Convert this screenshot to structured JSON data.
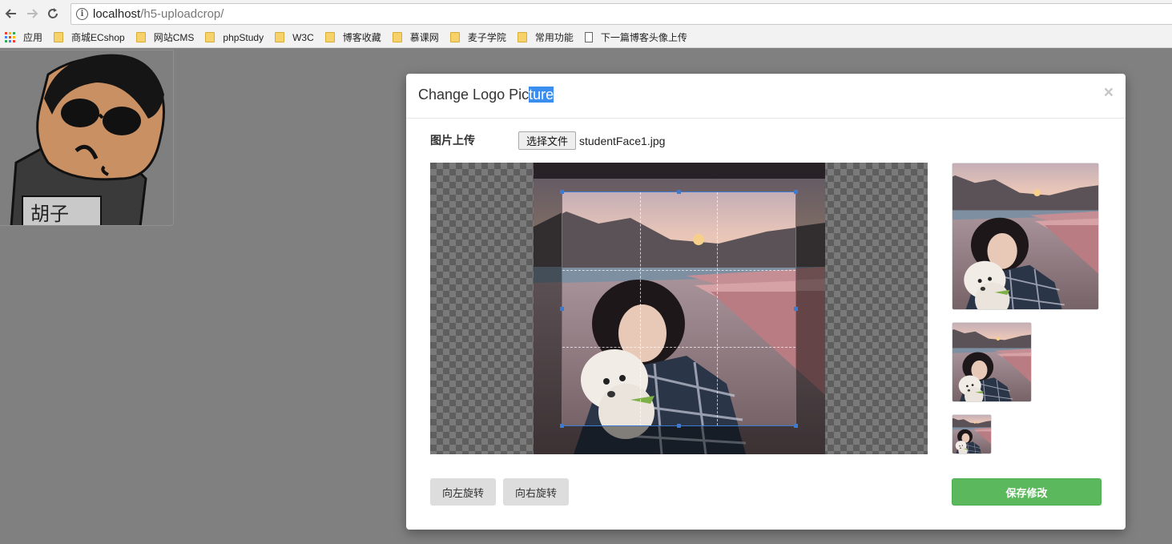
{
  "browser": {
    "url_host": "localhost",
    "url_path": "/h5-uploadcrop/",
    "bookmarks": [
      {
        "label": "应用",
        "type": "apps"
      },
      {
        "label": "商城ECshop",
        "type": "folder"
      },
      {
        "label": "网站CMS",
        "type": "folder"
      },
      {
        "label": "phpStudy",
        "type": "folder"
      },
      {
        "label": "W3C",
        "type": "folder"
      },
      {
        "label": "博客收藏",
        "type": "folder"
      },
      {
        "label": "慕课网",
        "type": "folder"
      },
      {
        "label": "麦子学院",
        "type": "folder"
      },
      {
        "label": "常用功能",
        "type": "folder"
      },
      {
        "label": "下一篇博客头像上传",
        "type": "page"
      }
    ]
  },
  "avatar": {
    "shirt_text": "胡子"
  },
  "modal": {
    "title_plain": "Change Logo Pic",
    "title_selected": "ture",
    "close": "×",
    "upload_label": "图片上传",
    "file_button": "选择文件",
    "file_name": "studentFace1.jpg",
    "rotate_left": "向左旋转",
    "rotate_right": "向右旋转",
    "save": "保存修改"
  },
  "colors": {
    "save_green": "#5cb85c",
    "crop_blue": "#3a7bd5",
    "selection_blue": "#3a8ef0"
  }
}
